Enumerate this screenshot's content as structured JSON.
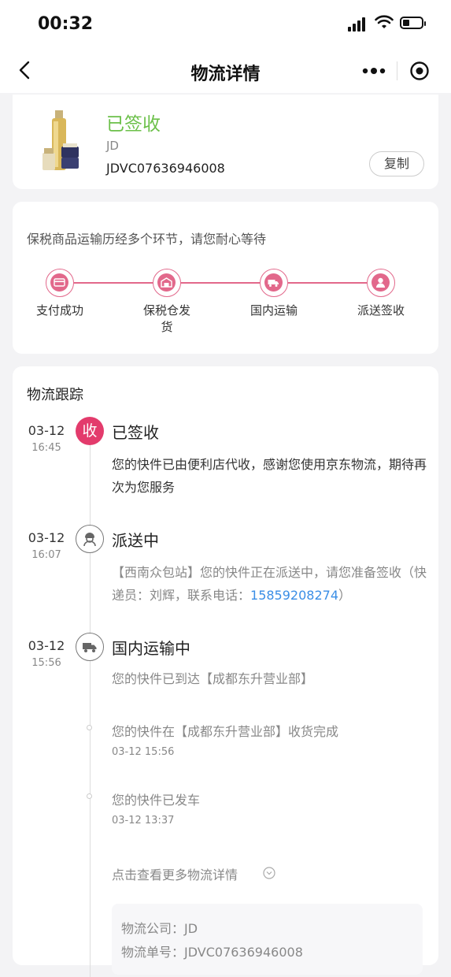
{
  "status_bar": {
    "time": "00:32"
  },
  "nav": {
    "title": "物流详情"
  },
  "package": {
    "status": "已签收",
    "company": "JD",
    "waybill": "JDVC07636946008",
    "copy_label": "复制"
  },
  "progress": {
    "notice": "保税商品运输历经多个环节，请您耐心等待",
    "steps": [
      {
        "label": "支付成功",
        "icon": "card-icon"
      },
      {
        "label": "保税仓发货",
        "icon": "warehouse-icon"
      },
      {
        "label": "国内运输",
        "icon": "truck-icon"
      },
      {
        "label": "派送签收",
        "icon": "courier-icon"
      }
    ]
  },
  "tracking": {
    "title": "物流跟踪",
    "events": [
      {
        "date": "03-12",
        "time": "16:45",
        "badge": "收",
        "title": "已签收",
        "text": "您的快件已由便利店代收，感谢您使用京东物流，期待再次为您服务"
      },
      {
        "date": "03-12",
        "time": "16:07",
        "title": "派送中",
        "text_before": "【西南众包站】您的快件正在派送中，请您准备签收（快递员：刘辉，联系电话：",
        "phone": "15859208274",
        "text_after": "）"
      },
      {
        "date": "03-12",
        "time": "15:56",
        "title": "国内运输中",
        "text": "您的快件已到达【成都东升营业部】"
      }
    ],
    "sub_events": [
      {
        "text": "您的快件在【成都东升营业部】收货完成",
        "time": "03-12 15:56"
      },
      {
        "text": "您的快件已发车",
        "time": "03-12 13:37"
      }
    ],
    "more_label": "点击查看更多物流详情",
    "info": {
      "company_label": "物流公司：",
      "company": "JD",
      "waybill_label": "物流单号：",
      "waybill": "JDVC07636946008"
    }
  }
}
